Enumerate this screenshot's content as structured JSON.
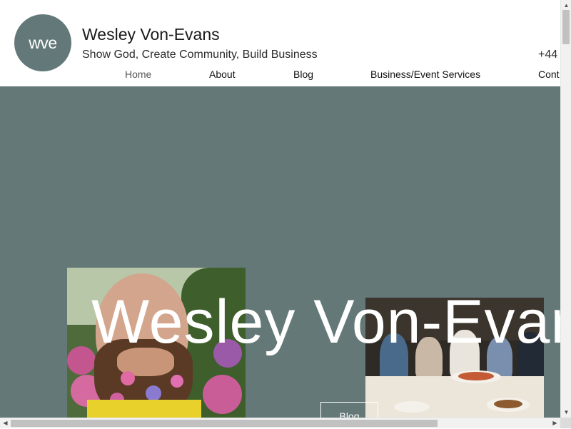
{
  "header": {
    "logo_text": "wve",
    "site_title": "Wesley Von-Evans",
    "tagline": "Show God, Create Community, Build Business",
    "phone_partial": "+44"
  },
  "nav": {
    "items": [
      {
        "label": "Home",
        "active": true
      },
      {
        "label": "About",
        "active": false
      },
      {
        "label": "Blog",
        "active": false
      },
      {
        "label": "Business/Event Services",
        "active": false
      },
      {
        "label": "Cont",
        "active": false
      }
    ]
  },
  "hero": {
    "title": "Wesley Von-Evans",
    "button_label": "Blog",
    "background_color": "#637877"
  },
  "scrollbars": {
    "up_arrow": "▲",
    "down_arrow": "▼",
    "left_arrow": "◀",
    "right_arrow": "▶"
  },
  "colors": {
    "brand": "#637878",
    "hero": "#637877",
    "text": "#1a1a1a"
  }
}
